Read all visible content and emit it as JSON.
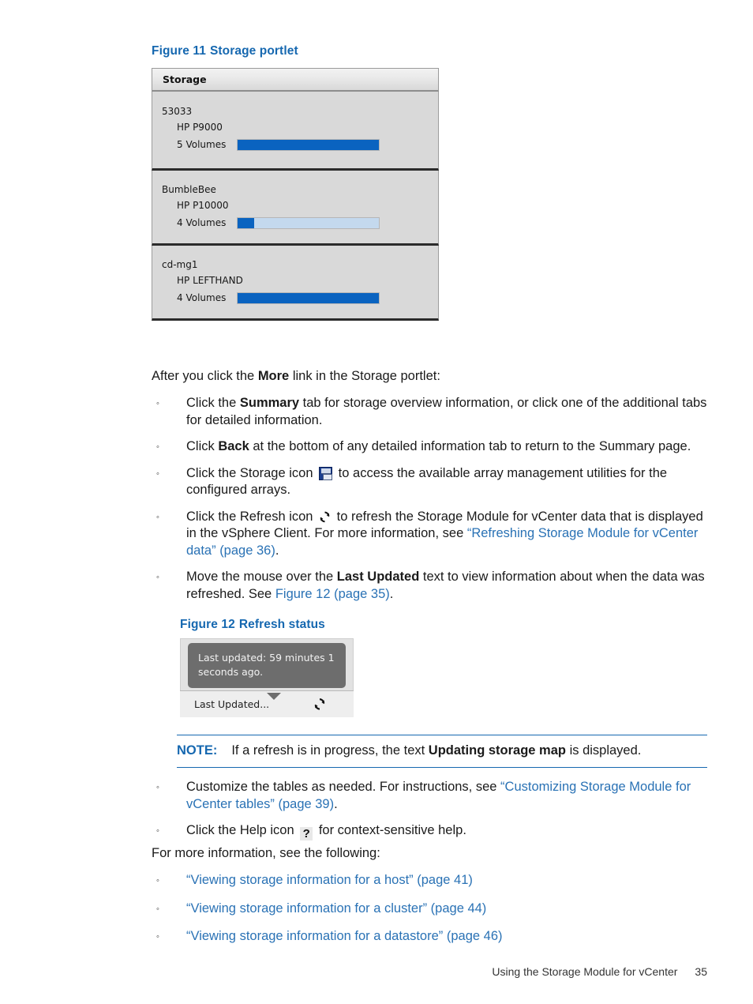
{
  "figure11": {
    "caption_number": "Figure 11",
    "caption_title": "Storage portlet",
    "portlet": {
      "header_title": "Storage",
      "sections": [
        {
          "name": "53033",
          "model": "HP P9000",
          "volumes": "5 Volumes",
          "fill_percent": 100
        },
        {
          "name": "BumbleBee",
          "model": "HP P10000",
          "volumes": "4 Volumes",
          "fill_percent": 12
        },
        {
          "name": "cd-mg1",
          "model": "HP LEFTHAND",
          "volumes": "4 Volumes",
          "fill_percent": 100
        }
      ]
    }
  },
  "intro": {
    "before_more": "After you click the ",
    "more": "More",
    "after_more": " link in the Storage portlet:"
  },
  "bullets_top": [
    {
      "marker": "◦",
      "parts": [
        {
          "text": "Click the ",
          "style": "normal"
        },
        {
          "text": "Summary",
          "style": "bold"
        },
        {
          "text": " tab for storage overview information, or click one of the additional tabs for detailed information.",
          "style": "normal"
        }
      ]
    },
    {
      "marker": "◦",
      "parts": [
        {
          "text": "Click ",
          "style": "normal"
        },
        {
          "text": "Back",
          "style": "bold"
        },
        {
          "text": " at the bottom of any detailed information tab to return to the Summary page.",
          "style": "normal"
        }
      ]
    },
    {
      "marker": "◦",
      "parts": [
        {
          "text": "Click the Storage icon ",
          "style": "normal"
        },
        {
          "text": "",
          "style": "icon",
          "icon": "storage-icon"
        },
        {
          "text": " to access the available array management utilities for the configured arrays.",
          "style": "normal"
        }
      ]
    },
    {
      "marker": "◦",
      "parts": [
        {
          "text": "Click the Refresh icon ",
          "style": "normal"
        },
        {
          "text": "",
          "style": "icon",
          "icon": "refresh-icon"
        },
        {
          "text": " to refresh the Storage Module for vCenter data that is displayed in the vSphere Client. For more information, see ",
          "style": "normal"
        },
        {
          "text": "“Refreshing Storage Module for vCenter data” (page 36)",
          "style": "link"
        },
        {
          "text": ".",
          "style": "normal"
        }
      ]
    },
    {
      "marker": "◦",
      "parts": [
        {
          "text": "Move the mouse over the ",
          "style": "normal"
        },
        {
          "text": "Last Updated",
          "style": "bold"
        },
        {
          "text": " text to view information about when the data was refreshed. See ",
          "style": "normal"
        },
        {
          "text": "Figure 12 (page 35)",
          "style": "link"
        },
        {
          "text": ".",
          "style": "normal"
        }
      ]
    }
  ],
  "figure12": {
    "caption_number": "Figure 12",
    "caption_title": "Refresh status",
    "tooltip_text": "Last updated: 59 minutes 1 seconds ago.",
    "last_updated_label": "Last Updated...",
    "refresh_icon": "refresh-icon"
  },
  "note": {
    "label": "NOTE:",
    "parts": [
      {
        "text": "If a refresh is in progress, the text ",
        "style": "normal"
      },
      {
        "text": "Updating storage map",
        "style": "bold"
      },
      {
        "text": " is displayed.",
        "style": "normal"
      }
    ]
  },
  "bullets_bottom": [
    {
      "marker": "◦",
      "parts": [
        {
          "text": "Customize the tables as needed. For instructions, see ",
          "style": "normal"
        },
        {
          "text": "“Customizing Storage Module for vCenter tables” (page 39)",
          "style": "link"
        },
        {
          "text": ".",
          "style": "normal"
        }
      ]
    },
    {
      "marker": "◦",
      "parts": [
        {
          "text": "Click the Help icon ",
          "style": "normal"
        },
        {
          "text": "",
          "style": "icon",
          "icon": "help-icon"
        },
        {
          "text": " for context-sensitive help.",
          "style": "normal"
        }
      ]
    }
  ],
  "more_info_lead": "For more information, see the following:",
  "link_list": [
    {
      "marker": "◦",
      "text": "“Viewing storage information for a host” (page 41)"
    },
    {
      "marker": "◦",
      "text": "“Viewing storage information for a cluster” (page 44)"
    },
    {
      "marker": "◦",
      "text": "“Viewing storage information for a datastore” (page 46)"
    }
  ],
  "footer": {
    "title": "Using the Storage Module for vCenter",
    "page_number": "35"
  },
  "colors": {
    "heading_blue": "#1668b0",
    "link_blue": "#2a72b5",
    "meter_fill": "#0a63c0",
    "meter_track": "#c4d9ee",
    "portlet_bg": "#d9d9d9",
    "tooltip_bg": "#6d6d6d"
  }
}
